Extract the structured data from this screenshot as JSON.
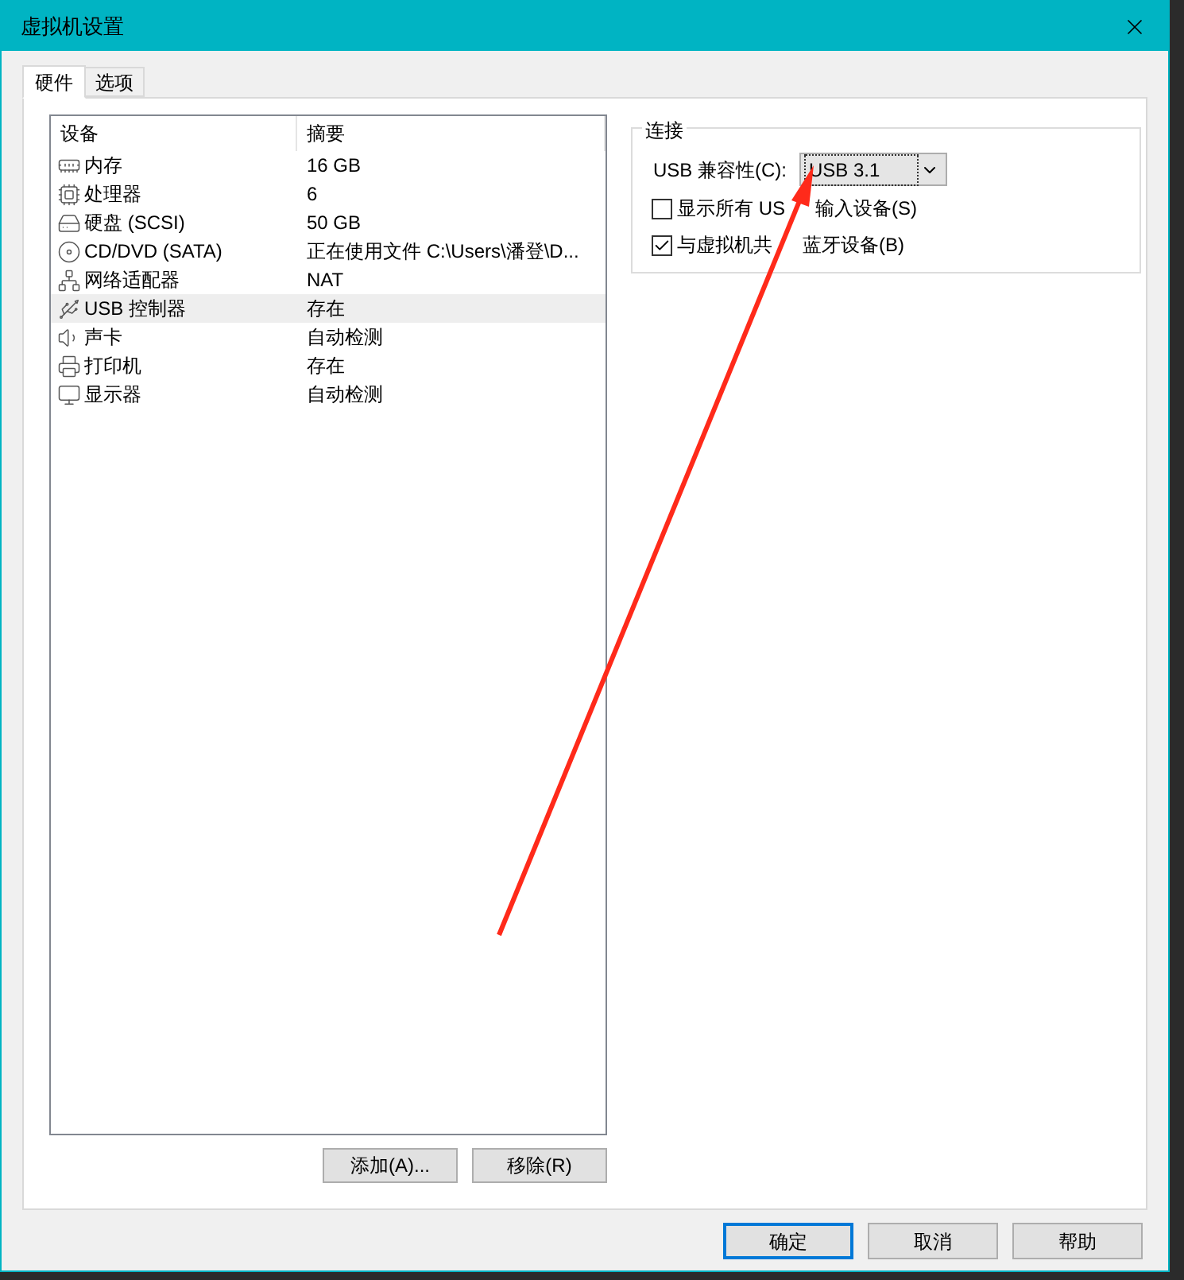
{
  "window": {
    "title": "虚拟机设置"
  },
  "tabs": [
    {
      "label": "硬件",
      "selected": true
    },
    {
      "label": "选项",
      "selected": false
    }
  ],
  "device_list": {
    "columns": [
      "设备",
      "摘要"
    ],
    "rows": [
      {
        "kind": "memory",
        "device": "内存",
        "summary": "16 GB",
        "selected": false
      },
      {
        "kind": "cpu",
        "device": "处理器",
        "summary": "6",
        "selected": false
      },
      {
        "kind": "disk",
        "device": "硬盘 (SCSI)",
        "summary": "50 GB",
        "selected": false
      },
      {
        "kind": "cd",
        "device": "CD/DVD (SATA)",
        "summary": "正在使用文件 C:\\Users\\潘登\\D...",
        "selected": false
      },
      {
        "kind": "network",
        "device": "网络适配器",
        "summary": "NAT",
        "selected": false
      },
      {
        "kind": "usb",
        "device": "USB 控制器",
        "summary": "存在",
        "selected": true
      },
      {
        "kind": "sound",
        "device": "声卡",
        "summary": "自动检测",
        "selected": false
      },
      {
        "kind": "printer",
        "device": "打印机",
        "summary": "存在",
        "selected": false
      },
      {
        "kind": "display",
        "device": "显示器",
        "summary": "自动检测",
        "selected": false
      }
    ]
  },
  "list_buttons": [
    "添加(A)...",
    "移除(R)"
  ],
  "connection": {
    "title": "连接",
    "compat_label": "USB 兼容性(C):",
    "compat_value": "USB 3.1",
    "options": [
      {
        "label_parts": [
          "显示所有 US",
          "输入设备(S)"
        ],
        "checked": false
      },
      {
        "label_parts": [
          "与虚拟机共",
          "蓝牙设备(B)"
        ],
        "checked": true
      }
    ]
  },
  "dialog_buttons": [
    {
      "label": "确定",
      "selected": true
    },
    {
      "label": "取消",
      "selected": false
    },
    {
      "label": "帮助",
      "selected": false
    }
  ]
}
